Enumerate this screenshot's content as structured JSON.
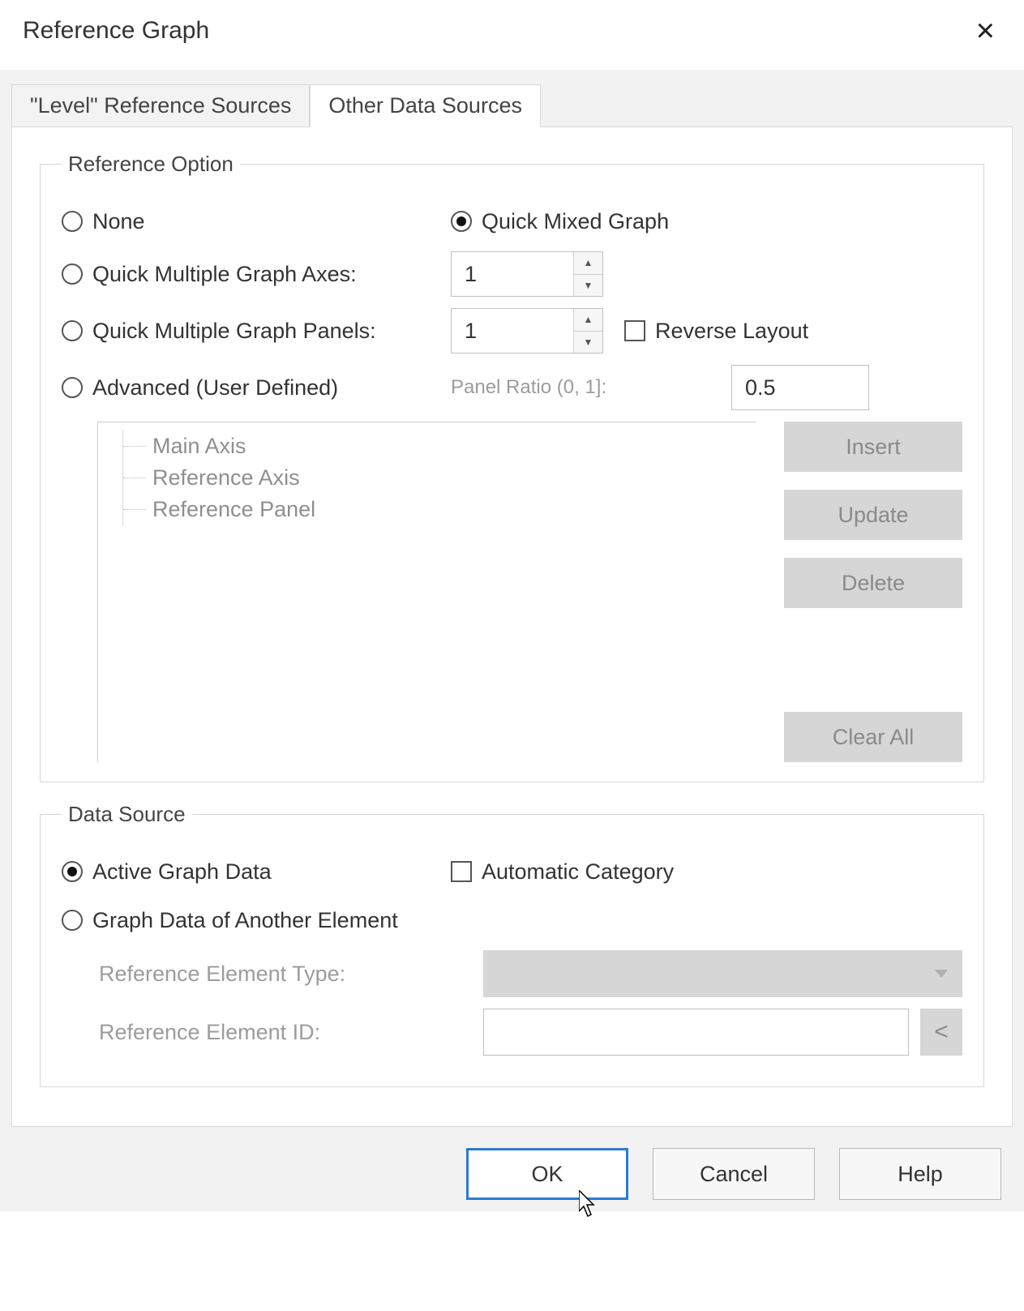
{
  "title": "Reference Graph",
  "tabs": {
    "level_ref": "\"Level\" Reference Sources",
    "other": "Other Data Sources"
  },
  "ref_option": {
    "legend": "Reference Option",
    "none": "None",
    "quick_mixed": "Quick Mixed Graph",
    "quick_axes": "Quick Multiple Graph Axes:",
    "quick_axes_value": "1",
    "quick_panels": "Quick Multiple Graph Panels:",
    "quick_panels_value": "1",
    "reverse_layout": "Reverse Layout",
    "advanced": "Advanced (User Defined)",
    "panel_ratio_label": "Panel Ratio (0, 1]:",
    "panel_ratio_value": "0.5",
    "tree": {
      "main_axis": "Main Axis",
      "ref_axis": "Reference Axis",
      "ref_panel": "Reference Panel"
    },
    "buttons": {
      "insert": "Insert",
      "update": "Update",
      "delete": "Delete",
      "clear_all": "Clear All"
    }
  },
  "data_source": {
    "legend": "Data Source",
    "active_graph": "Active Graph Data",
    "auto_category": "Automatic Category",
    "another_element": "Graph Data of Another Element",
    "ref_type_label": "Reference Element Type:",
    "ref_id_label": "Reference Element ID:",
    "ref_id_value": "",
    "picker": "<"
  },
  "footer": {
    "ok": "OK",
    "cancel": "Cancel",
    "help": "Help"
  }
}
